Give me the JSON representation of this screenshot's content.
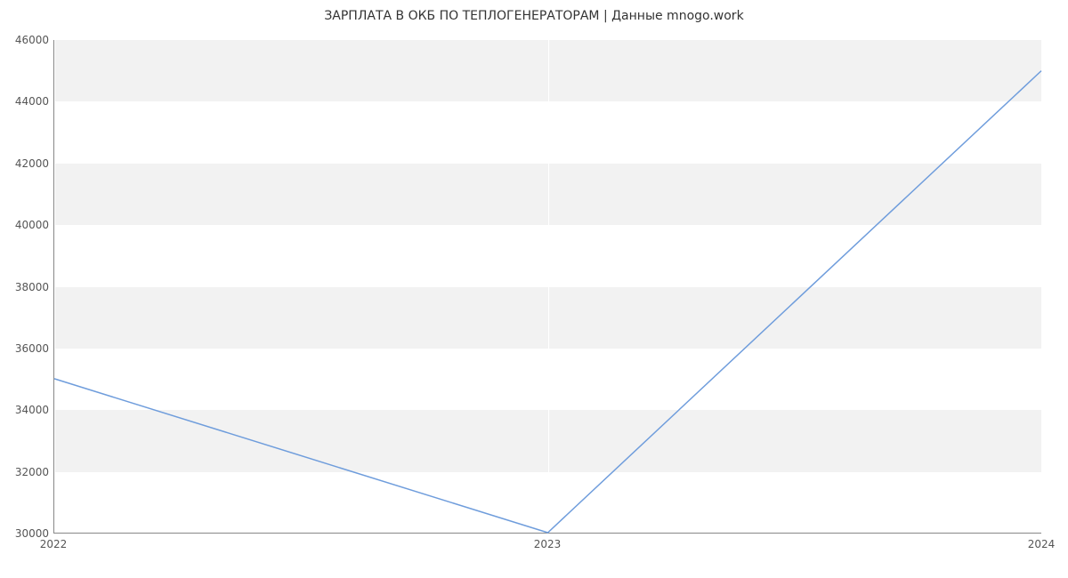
{
  "chart_data": {
    "type": "line",
    "title": "ЗАРПЛАТА В  ОКБ ПО ТЕПЛОГЕНЕРАТОРАМ | Данные mnogo.work",
    "xlabel": "",
    "ylabel": "",
    "x": [
      2022,
      2023,
      2024
    ],
    "values": [
      35000,
      30000,
      45000
    ],
    "x_ticks": [
      2022,
      2023,
      2024
    ],
    "y_ticks": [
      30000,
      32000,
      34000,
      36000,
      38000,
      40000,
      42000,
      44000,
      46000
    ],
    "ylim": [
      30000,
      46000
    ],
    "xlim": [
      2022,
      2024
    ],
    "line_color": "#6f9ddc",
    "band_color": "#f2f2f2"
  }
}
